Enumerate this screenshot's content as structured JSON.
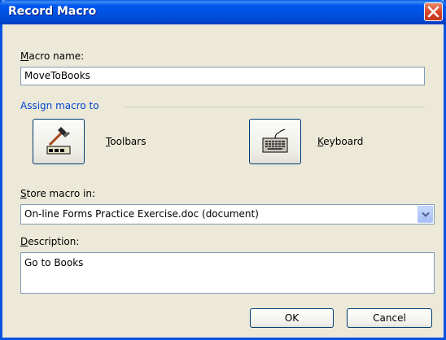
{
  "window": {
    "title": "Record Macro"
  },
  "macro_name": {
    "label_accel": "M",
    "label_rest": "acro name:",
    "value": "MoveToBooks"
  },
  "assign": {
    "group_label": "Assign macro to",
    "toolbars_accel": "T",
    "toolbars_rest": "oolbars",
    "keyboard_accel": "K",
    "keyboard_rest": "eyboard",
    "toolbars_icon": "hammer-toolbar-icon",
    "keyboard_icon": "keyboard-icon"
  },
  "store": {
    "label_accel": "S",
    "label_rest": "tore macro in:",
    "value": "On-line Forms Practice Exercise.doc (document)"
  },
  "description": {
    "label_accel": "D",
    "label_rest": "escription:",
    "value": "Go to Books"
  },
  "buttons": {
    "ok": "OK",
    "cancel": "Cancel"
  },
  "colors": {
    "titlebar": "#0054e3",
    "close": "#d8462a",
    "group_label": "#0046d5",
    "dialog_bg": "#ece9d8"
  }
}
